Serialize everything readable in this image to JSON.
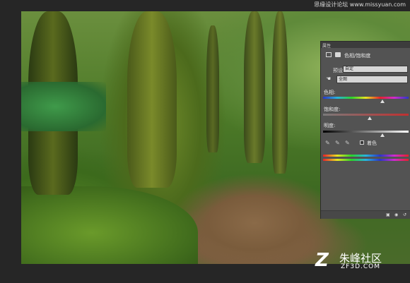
{
  "watermark": {
    "top_text": "思缘设计论坛 www.missyuan.com",
    "logo_chinese": "朱峰社区",
    "logo_url": "ZF3D.COM"
  },
  "panel": {
    "tab_label": "属性",
    "header_title": "色相/饱和度",
    "preset_label": "预设:",
    "preset_value": "自定",
    "channel_value": "全图",
    "hue_label": "色相:",
    "hue_value": 0,
    "saturation_label": "饱和度:",
    "saturation_value": 0,
    "lightness_label": "明度:",
    "lightness_value": 0,
    "colorize_label": "着色",
    "colorize_checked": false
  },
  "colors": {
    "panel_bg": "#535353",
    "app_bg": "#262626"
  }
}
